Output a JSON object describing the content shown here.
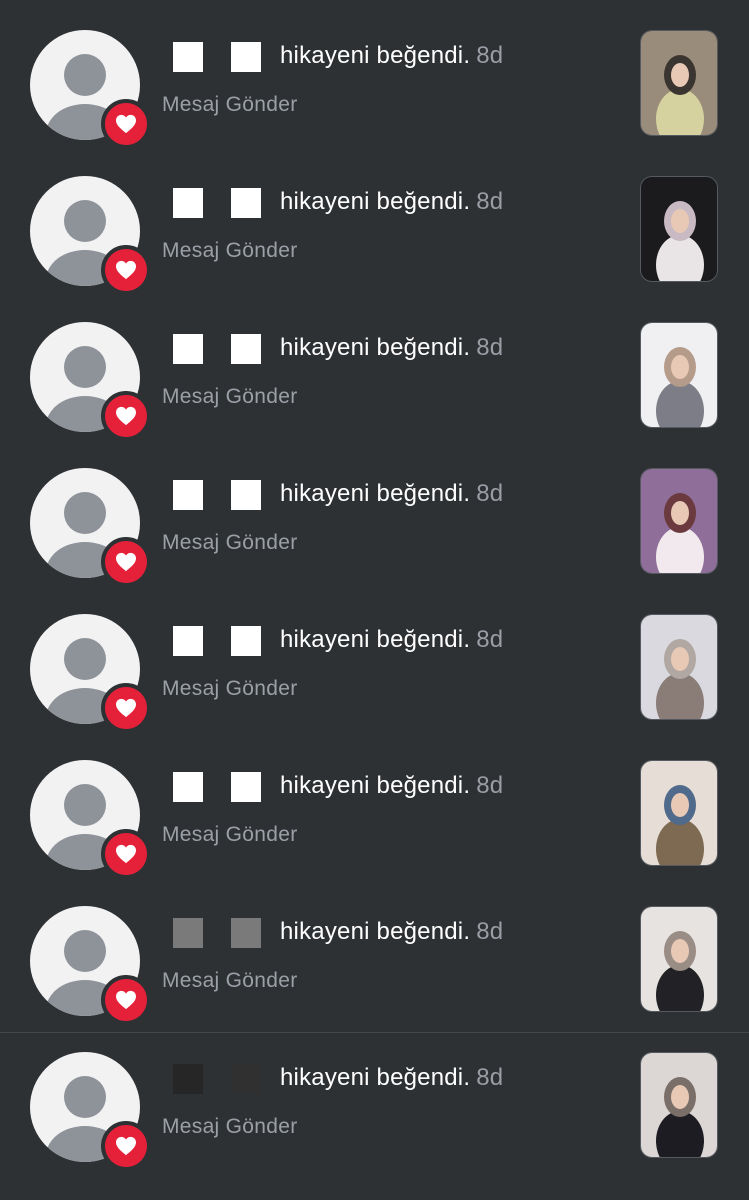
{
  "notifications": [
    {
      "activity": "hikayeni beğendi.",
      "time": "8d",
      "action": "Mesaj Gönder",
      "thumbnail": {
        "description_icon": "story-photo-icon",
        "colors": [
          "#9a8c7a",
          "#d6d2a0",
          "#3a3530"
        ]
      }
    },
    {
      "activity": "hikayeni beğendi.",
      "time": "8d",
      "action": "Mesaj Gönder",
      "thumbnail": {
        "description_icon": "story-photo-icon",
        "colors": [
          "#1b1b1d",
          "#e9e4e6",
          "#c9b9c2"
        ]
      }
    },
    {
      "activity": "hikayeni beğendi.",
      "time": "8d",
      "action": "Mesaj Gönder",
      "thumbnail": {
        "description_icon": "story-photo-icon",
        "colors": [
          "#f0f0f2",
          "#7d7d88",
          "#b59b8a"
        ]
      }
    },
    {
      "activity": "hikayeni beğendi.",
      "time": "8d",
      "action": "Mesaj Gönder",
      "thumbnail": {
        "description_icon": "story-photo-icon",
        "colors": [
          "#8f6f9a",
          "#f2e9ee",
          "#6b3a3e"
        ]
      }
    },
    {
      "activity": "hikayeni beğendi.",
      "time": "8d",
      "action": "Mesaj Gönder",
      "thumbnail": {
        "description_icon": "story-photo-icon",
        "colors": [
          "#d9d9df",
          "#8a7d78",
          "#b1a7a3"
        ]
      }
    },
    {
      "activity": "hikayeni beğendi.",
      "time": "8d",
      "action": "Mesaj Gönder",
      "thumbnail": {
        "description_icon": "story-photo-icon",
        "colors": [
          "#e6ddd6",
          "#7e6a53",
          "#4f6a8a"
        ]
      }
    },
    {
      "activity": "hikayeni beğendi.",
      "time": "8d",
      "action": "Mesaj Gönder",
      "thumbnail": {
        "description_icon": "story-photo-icon",
        "colors": [
          "#e7e3e1",
          "#222226",
          "#9a8d86"
        ]
      }
    },
    {
      "activity": "hikayeni beğendi.",
      "time": "8d",
      "action": "Mesaj Gönder",
      "thumbnail": {
        "description_icon": "story-photo-icon",
        "colors": [
          "#dcd7d4",
          "#1c1c22",
          "#7a6e68"
        ]
      }
    }
  ],
  "theme": {
    "background": "#2e3134",
    "heart_badge": "#e5213a",
    "secondary_text": "#9ba0a6",
    "primary_text": "#ffffff"
  },
  "icons": {
    "avatar": "default-avatar-icon",
    "badge": "heart-icon"
  }
}
